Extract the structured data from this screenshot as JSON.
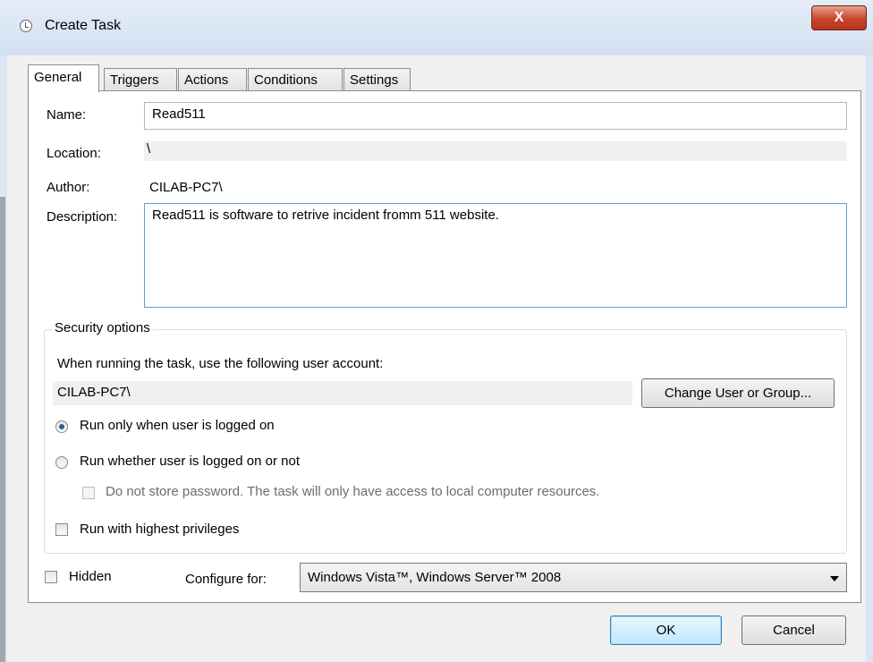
{
  "window": {
    "title": "Create Task",
    "close_label": "X"
  },
  "tabs": [
    {
      "label": "General"
    },
    {
      "label": "Triggers"
    },
    {
      "label": "Actions"
    },
    {
      "label": "Conditions"
    },
    {
      "label": "Settings"
    }
  ],
  "general": {
    "name_label": "Name:",
    "name_value": "Read511",
    "location_label": "Location:",
    "location_value": "\\",
    "author_label": "Author:",
    "author_value": "CILAB-PC7\\",
    "description_label": "Description:",
    "description_value": "Read511 is software to retrive incident fromm 511 website."
  },
  "security": {
    "legend": "Security options",
    "account_prompt": "When running the task, use the following user account:",
    "account_value": "CILAB-PC7\\",
    "change_button": "Change User or Group...",
    "radio_logged_on": "Run only when user is logged on",
    "radio_whether": "Run whether user is logged on or not",
    "no_store_password": "Do not store password.  The task will only have access to local computer resources.",
    "highest_privileges": "Run with highest privileges"
  },
  "bottom": {
    "hidden_label": "Hidden",
    "configure_label": "Configure for:",
    "configure_value": "Windows Vista™, Windows Server™ 2008"
  },
  "buttons": {
    "ok": "OK",
    "cancel": "Cancel"
  }
}
